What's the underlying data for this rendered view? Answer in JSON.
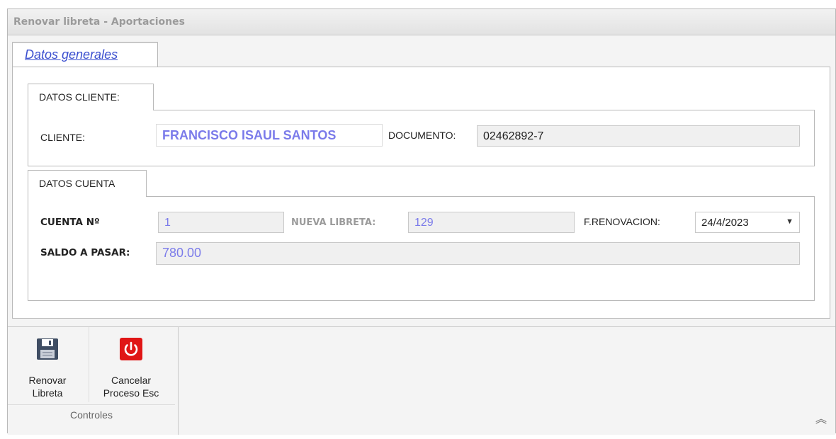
{
  "window": {
    "title": "Renovar libreta - Aportaciones"
  },
  "tabs": [
    {
      "label": "Datos generales",
      "active": true
    }
  ],
  "datos_cliente": {
    "group_label": "DATOS CLIENTE:",
    "cliente_label": "CLIENTE:",
    "cliente_value": "FRANCISCO ISAUL SANTOS",
    "documento_label": "DOCUMENTO:",
    "documento_value": "02462892-7"
  },
  "datos_cuenta": {
    "group_label": "DATOS CUENTA",
    "cuenta_label": "CUENTA Nº",
    "cuenta_value": "1",
    "nueva_libreta_label": "NUEVA LIBRETA:",
    "nueva_libreta_value": "129",
    "renovacion_label": "F.RENOVACION:",
    "renovacion_value": "24/4/2023",
    "saldo_label": "SALDO A PASAR:",
    "saldo_value": "780.00"
  },
  "ribbon": {
    "group_label": "Controles",
    "buttons": [
      {
        "line1": "Renovar",
        "line2": "Libreta",
        "icon": "save-icon"
      },
      {
        "line1": "Cancelar",
        "line2": "Proceso Esc",
        "icon": "power-icon"
      }
    ],
    "collapse_icon": "chevron-up-icon"
  },
  "colors": {
    "value_text": "#7b7bea",
    "tab_link": "#3b4fcf",
    "cancel_red": "#e01616"
  }
}
